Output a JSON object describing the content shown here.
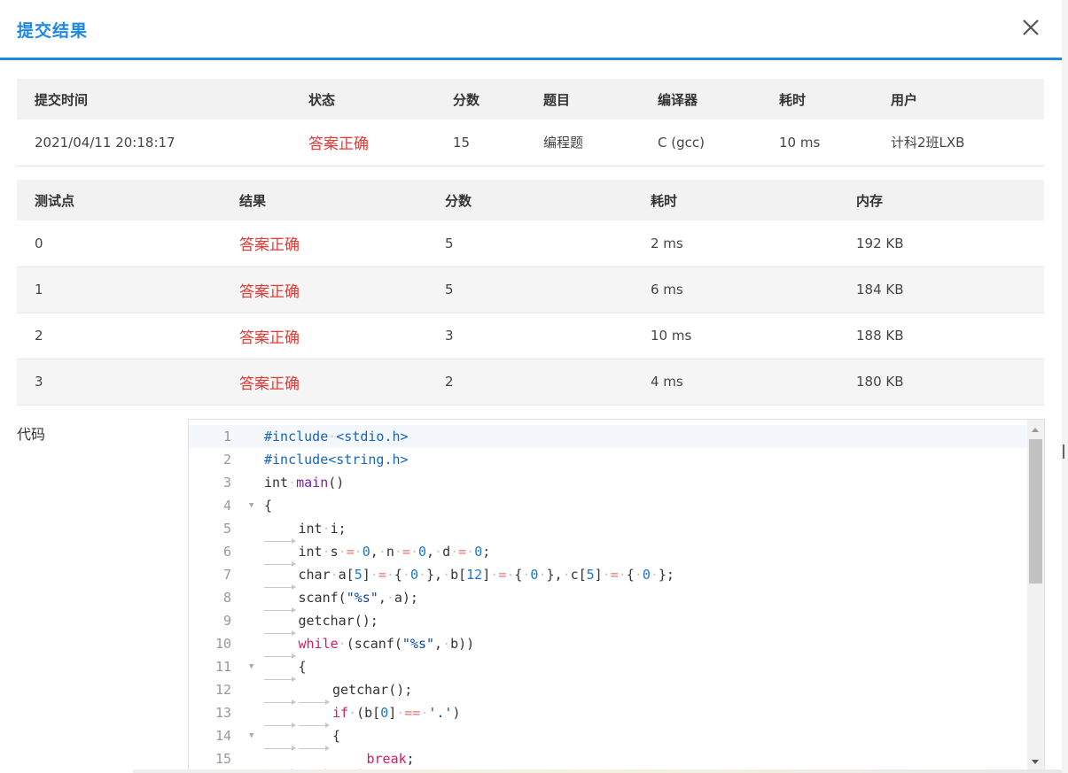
{
  "dialog": {
    "title": "提交结果",
    "close_icon": "close-icon"
  },
  "summary": {
    "headers": [
      "提交时间",
      "状态",
      "分数",
      "题目",
      "编译器",
      "耗时",
      "用户"
    ],
    "row": {
      "time": "2021/04/11 20:18:17",
      "status": "答案正确",
      "score": "15",
      "problem": "编程题",
      "compiler": "C (gcc)",
      "elapsed": "10 ms",
      "user": "计科2班LXB"
    }
  },
  "cases": {
    "headers": [
      "测试点",
      "结果",
      "分数",
      "耗时",
      "内存"
    ],
    "rows": [
      {
        "id": "0",
        "result": "答案正确",
        "score": "5",
        "time": "2 ms",
        "memory": "192 KB"
      },
      {
        "id": "1",
        "result": "答案正确",
        "score": "5",
        "time": "6 ms",
        "memory": "184 KB"
      },
      {
        "id": "2",
        "result": "答案正确",
        "score": "3",
        "time": "10 ms",
        "memory": "188 KB"
      },
      {
        "id": "3",
        "result": "答案正确",
        "score": "2",
        "time": "4 ms",
        "memory": "180 KB"
      }
    ]
  },
  "code": {
    "label": "代码",
    "line_numbers": [
      "1",
      "2",
      "3",
      "4",
      "5",
      "6",
      "7",
      "8",
      "9",
      "10",
      "11",
      "12",
      "13",
      "14",
      "15"
    ],
    "lines": [
      "#include <stdio.h>",
      "#include<string.h>",
      "int main()",
      "{",
      "\tint i;",
      "\tint s = 0, n = 0, d = 0;",
      "\tchar a[5] = { 0 }, b[12] = { 0 }, c[5] = { 0 };",
      "\tscanf(\"%s\", a);",
      "\tgetchar();",
      "\twhile (scanf(\"%s\", b))",
      "\t{",
      "\t\tgetchar();",
      "\t\tif (b[0] == '.')",
      "\t\t{",
      "\t\t\tbreak;"
    ],
    "folds": [
      "4",
      "11",
      "14"
    ]
  },
  "colors": {
    "accent": "#1e88e5",
    "status_ok": "#e53935",
    "header_bg": "#f2f2f2"
  }
}
